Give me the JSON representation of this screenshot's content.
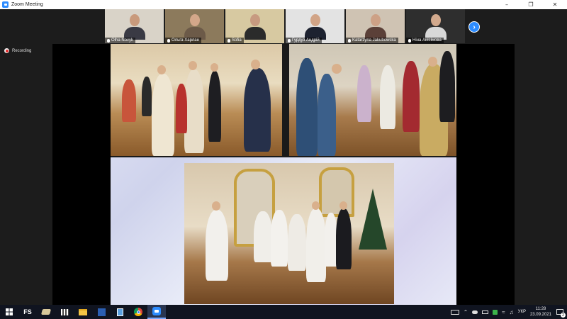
{
  "window": {
    "title": "Zoom Meeting"
  },
  "recording": {
    "label": "Recording"
  },
  "participants": [
    {
      "name": "Olha Novyk",
      "bg": "#d9d3c8",
      "skin": "#c99a7c",
      "shirt": "#3a3a44"
    },
    {
      "name": "Ольга Харлан",
      "bg": "#8c7a5c",
      "skin": "#d3a78a",
      "shirt": "#6c5a48"
    },
    {
      "name": "Sofia",
      "bg": "#d7c9a1",
      "skin": "#c79a80",
      "shirt": "#2b2b2b"
    },
    {
      "name": "Гурдуз Андрій",
      "bg": "#e3e3e3",
      "skin": "#d1a487",
      "shirt": "#1d2230"
    },
    {
      "name": "Katarzyna Jakubowska",
      "bg": "#cfc3b3",
      "skin": "#cda186",
      "shirt": "#5b4038"
    },
    {
      "name": "Ніна Анісімова",
      "bg": "#2e2e2e",
      "skin": "#d2a98d",
      "shirt": "#d8d8d8"
    }
  ],
  "taskbar": {
    "apps": [
      {
        "icon": "fs-app-icon",
        "label": "FS"
      },
      {
        "icon": "chess-app-icon",
        "label": ""
      },
      {
        "icon": "video-editor-icon",
        "label": ""
      },
      {
        "icon": "file-explorer-icon",
        "label": ""
      },
      {
        "icon": "word-icon",
        "label": ""
      },
      {
        "icon": "calculator-icon",
        "label": ""
      },
      {
        "icon": "chrome-icon",
        "label": ""
      },
      {
        "icon": "zoom-icon",
        "label": ""
      }
    ],
    "language": "УКР",
    "time": "11:28",
    "date": "23.09.2021",
    "notifications_count": "2"
  },
  "colors": {
    "accent": "#2d8cff",
    "recording": "#e02828"
  }
}
